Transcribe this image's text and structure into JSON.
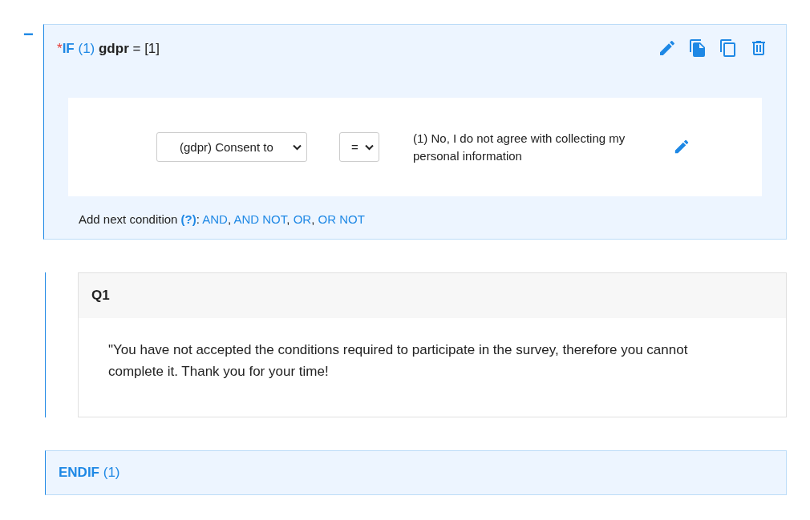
{
  "condition_block": {
    "collapse_symbol": "−",
    "required_mark": "*",
    "keyword": "IF",
    "number": "(1)",
    "variable": "gdpr",
    "expression": "= [1]",
    "actions": [
      {
        "kind": "edit"
      },
      {
        "kind": "duplicate"
      },
      {
        "kind": "copy"
      },
      {
        "kind": "delete"
      }
    ],
    "condition": {
      "question_select": "(gdpr) Consent to",
      "operator_select": "=",
      "answer": "(1) No, I do not agree with collecting my personal information"
    },
    "add_next": {
      "label": "Add next condition",
      "help": "(?)",
      "colon": ":",
      "separator": ",",
      "links": [
        "AND",
        "AND NOT",
        "OR",
        "OR NOT"
      ]
    }
  },
  "question": {
    "code": "Q1",
    "text": "\"You have not accepted the conditions required to participate in the survey, therefore you cannot complete it. Thank you for your time!"
  },
  "end_block": {
    "keyword": "ENDIF",
    "number": "(1)"
  }
}
